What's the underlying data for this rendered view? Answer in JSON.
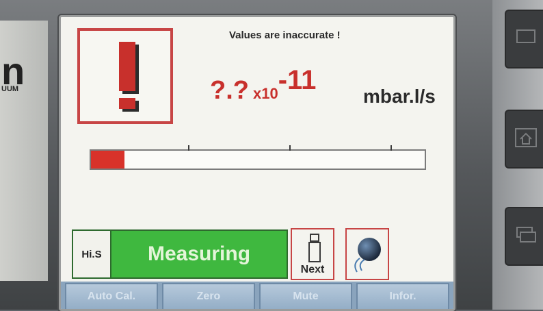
{
  "device": {
    "brand_fragment": "n",
    "brand_subtext": "UUM"
  },
  "alert": {
    "message": "Values are inaccurate !",
    "icon": "exclamation-icon",
    "color": "#c8302c"
  },
  "reading": {
    "mantissa": "?.?",
    "multiplier": "x10",
    "exponent": "-11",
    "unit": "mbar.l/s"
  },
  "level_bar": {
    "fill_fraction": 0.1,
    "fill_color": "#d8322a"
  },
  "status": {
    "mode": "Hi.S",
    "state": "Measuring",
    "color": "#3fb83f"
  },
  "buttons": {
    "next_label": "Next",
    "next_icon": "info-icon",
    "speaker_icon": "speaker-icon"
  },
  "softkeys": [
    "Auto Cal.",
    "Zero",
    "Mute",
    "Infor."
  ],
  "side_buttons": [
    "monitor-icon",
    "home-icon",
    "window-stack-icon"
  ]
}
